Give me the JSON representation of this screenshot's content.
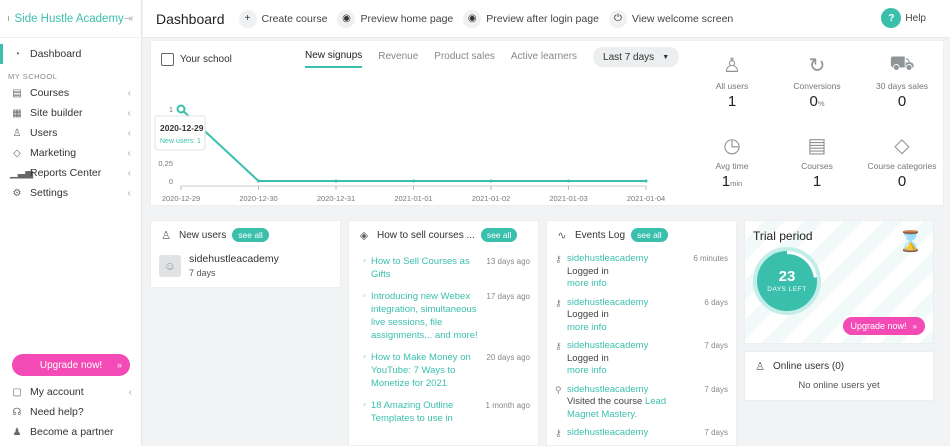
{
  "brand": {
    "name": "Side Hustle Academy"
  },
  "sidebar": {
    "dashboard": "Dashboard",
    "section": "MY SCHOOL",
    "items": [
      {
        "label": "Courses"
      },
      {
        "label": "Site builder"
      },
      {
        "label": "Users"
      },
      {
        "label": "Marketing"
      },
      {
        "label": "Reports Center"
      },
      {
        "label": "Settings"
      }
    ],
    "upgrade": "Upgrade now!",
    "bottom": [
      {
        "label": "My account"
      },
      {
        "label": "Need help?"
      },
      {
        "label": "Become a partner"
      }
    ]
  },
  "topbar": {
    "title": "Dashboard",
    "create": "Create course",
    "preview_home": "Preview home page",
    "preview_login": "Preview after login page",
    "welcome": "View welcome screen",
    "help": "Help"
  },
  "school": {
    "label": "Your school",
    "tabs": [
      "New signups",
      "Revenue",
      "Product sales",
      "Active learners"
    ],
    "range": "Last 7 days"
  },
  "chart_data": {
    "type": "line",
    "x": [
      "2020-12-29",
      "2020-12-30",
      "2020-12-31",
      "2021-01-01",
      "2021-01-02",
      "2021-01-03",
      "2021-01-04"
    ],
    "values": [
      1,
      0,
      0,
      0,
      0,
      0,
      0
    ],
    "yticks": [
      "1",
      "0.25",
      "0"
    ],
    "ylim": [
      0,
      1
    ],
    "tooltip": {
      "date": "2020-12-29",
      "text": "New users: 1"
    },
    "line_color": "#3bbfad"
  },
  "stats": [
    {
      "label": "All users",
      "value": "1",
      "unit": ""
    },
    {
      "label": "Conversions",
      "value": "0",
      "unit": "%"
    },
    {
      "label": "30 days sales",
      "value": "0",
      "unit": ""
    },
    {
      "label": "Avg time",
      "value": "1",
      "unit": "min"
    },
    {
      "label": "Courses",
      "value": "1",
      "unit": ""
    },
    {
      "label": "Course categories",
      "value": "0",
      "unit": ""
    }
  ],
  "new_users": {
    "title": "New users",
    "see_all": "see all",
    "user": {
      "name": "sidehustleacademy",
      "days": "7 days"
    }
  },
  "blog": {
    "title": "How to sell courses ...",
    "see_all": "see all",
    "items": [
      {
        "title": "How to Sell Courses as Gifts",
        "date": "13 days ago"
      },
      {
        "title": "Introducing new Webex integration, simultaneous live sessions, file assignments... and more!",
        "date": "17 days ago"
      },
      {
        "title": "How to Make Money on YouTube: 7 Ways to Monetize for 2021",
        "date": "20 days ago"
      },
      {
        "title": "18 Amazing Outline Templates to use in",
        "date": "1 month ago"
      }
    ]
  },
  "events": {
    "title": "Events Log",
    "see_all": "see all",
    "items": [
      {
        "user": "sidehustleacademy",
        "action": "Logged in",
        "extra": "more info",
        "time": "6 minutes"
      },
      {
        "user": "sidehustleacademy",
        "action": "Logged in",
        "extra": "more info",
        "time": "6 days"
      },
      {
        "user": "sidehustleacademy",
        "action": "Logged in",
        "extra": "more info",
        "time": "7 days"
      },
      {
        "user": "sidehustleacademy",
        "action": "Visited the course",
        "course": "Lead Magnet Mastery.",
        "time": "7 days"
      },
      {
        "user": "sidehustleacademy",
        "time": "7 days"
      }
    ]
  },
  "trial": {
    "title": "Trial period",
    "days": "23",
    "days_label": "DAYS LEFT",
    "upgrade": "Upgrade now!",
    "progress": 0.23
  },
  "online": {
    "title": "Online users (0)",
    "empty": "No online users yet"
  }
}
